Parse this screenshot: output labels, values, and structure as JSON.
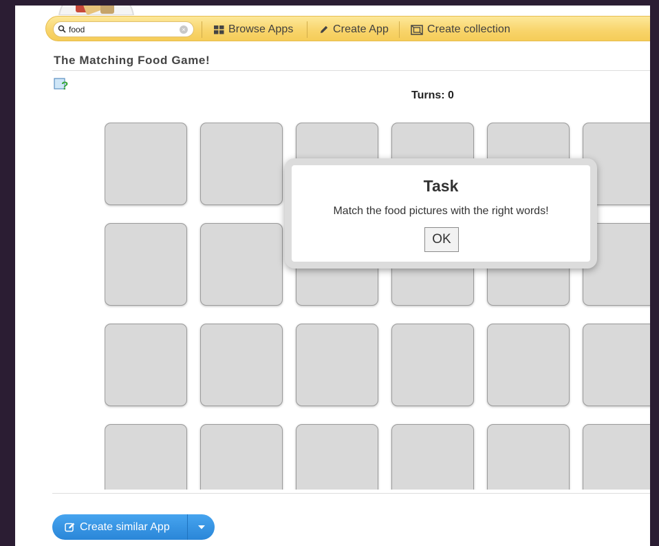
{
  "toolbar": {
    "search_value": "food",
    "browse_label": "Browse Apps",
    "create_app_label": "Create App",
    "create_collection_label": "Create collection"
  },
  "page": {
    "title": "The Matching Food Game!",
    "turns_label": "Turns: 0"
  },
  "grid": {
    "rows": 4,
    "columns": 6
  },
  "dialog": {
    "title": "Task",
    "message": "Match the food pictures with the right words!",
    "ok_label": "OK"
  },
  "footer": {
    "create_similar_label": "Create similar App"
  },
  "colors": {
    "toolbar": "#f8d46a",
    "card": "#d9d9d9",
    "primary_button": "#2a86d8",
    "background": "#2b1d33"
  }
}
